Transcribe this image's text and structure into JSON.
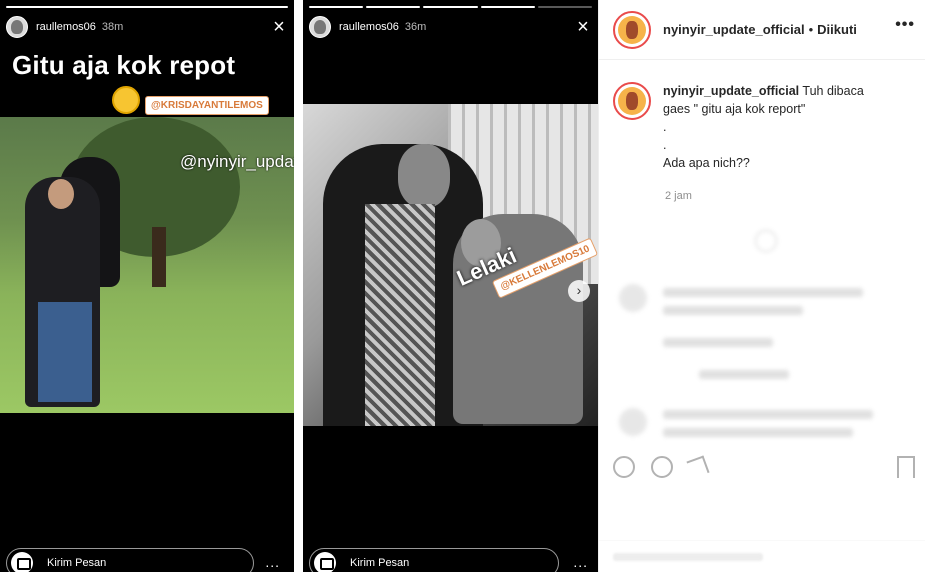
{
  "story_left": {
    "username": "raullemos06",
    "time": "38m",
    "caption": "Gitu aja kok repot",
    "mention": "@KRISDAYANTILEMOS",
    "watermark": "@nyinyir_update_official",
    "reply_placeholder": "Kirim Pesan",
    "more": "...",
    "close": "×",
    "progress_done": 1,
    "progress_total": 1
  },
  "story_right": {
    "username": "raullemos06",
    "time": "36m",
    "sticker_text": "Lelaki",
    "mention": "@KELLENLEMOS10",
    "reply_placeholder": "Kirim Pesan",
    "more": "...",
    "close": "×",
    "next": "›",
    "progress_done": 4,
    "progress_total": 5
  },
  "post": {
    "username": "nyinyir_update_official",
    "separator": "•",
    "follow_status": "Diikuti",
    "more": "•••",
    "caption_user": "nyinyir_update_official",
    "caption_lines": [
      "Tuh dibaca",
      "gaes \" gitu aja kok report\"",
      ".",
      ".",
      "Ada apa nich??"
    ],
    "time": "2 jam"
  },
  "colors": {
    "story_bg": "#000000",
    "mention_text": "#d87a3a",
    "avatar_ring": "#e94b4b",
    "secondary_text": "#8e8e8e"
  },
  "icons": {
    "close": "close-icon",
    "camera": "camera-icon",
    "more": "more-dots-icon",
    "next": "chevron-right-icon",
    "like": "heart-icon",
    "comment": "comment-icon",
    "share": "share-icon",
    "save": "bookmark-icon"
  }
}
